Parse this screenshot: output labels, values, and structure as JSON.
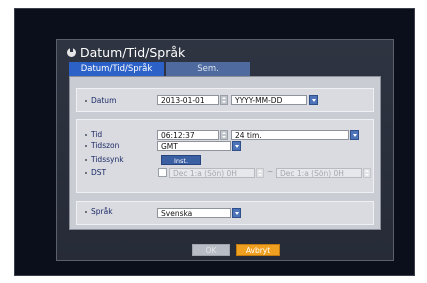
{
  "dialog": {
    "title": "Datum/Tid/Språk",
    "tabs": [
      {
        "label": "Datum/Tid/Språk",
        "active": true
      },
      {
        "label": "Sem.",
        "active": false
      }
    ]
  },
  "date_section": {
    "label": "Datum",
    "date_value": "2013-01-01",
    "format_value": "YYYY-MM-DD"
  },
  "time_section": {
    "time_label": "Tid",
    "time_value": "06:12:37",
    "time_format_value": "24 tim.",
    "timezone_label": "Tidszon",
    "timezone_value": "GMT",
    "timesync_label": "Tidssynk",
    "timesync_button": "Inst.",
    "dst_label": "DST",
    "dst_enabled": false,
    "dst_start": "Dec 1:a (Sön) 0H",
    "dst_separator": "~",
    "dst_end": "Dec 1:a (Sön) 0H"
  },
  "language_section": {
    "label": "Språk",
    "value": "Svenska"
  },
  "buttons": {
    "ok": "OK",
    "cancel": "Avbryt"
  },
  "colors": {
    "active_tab": "#2c62c7",
    "cancel_button": "#f0a020",
    "label_text": "#1c2a66"
  }
}
